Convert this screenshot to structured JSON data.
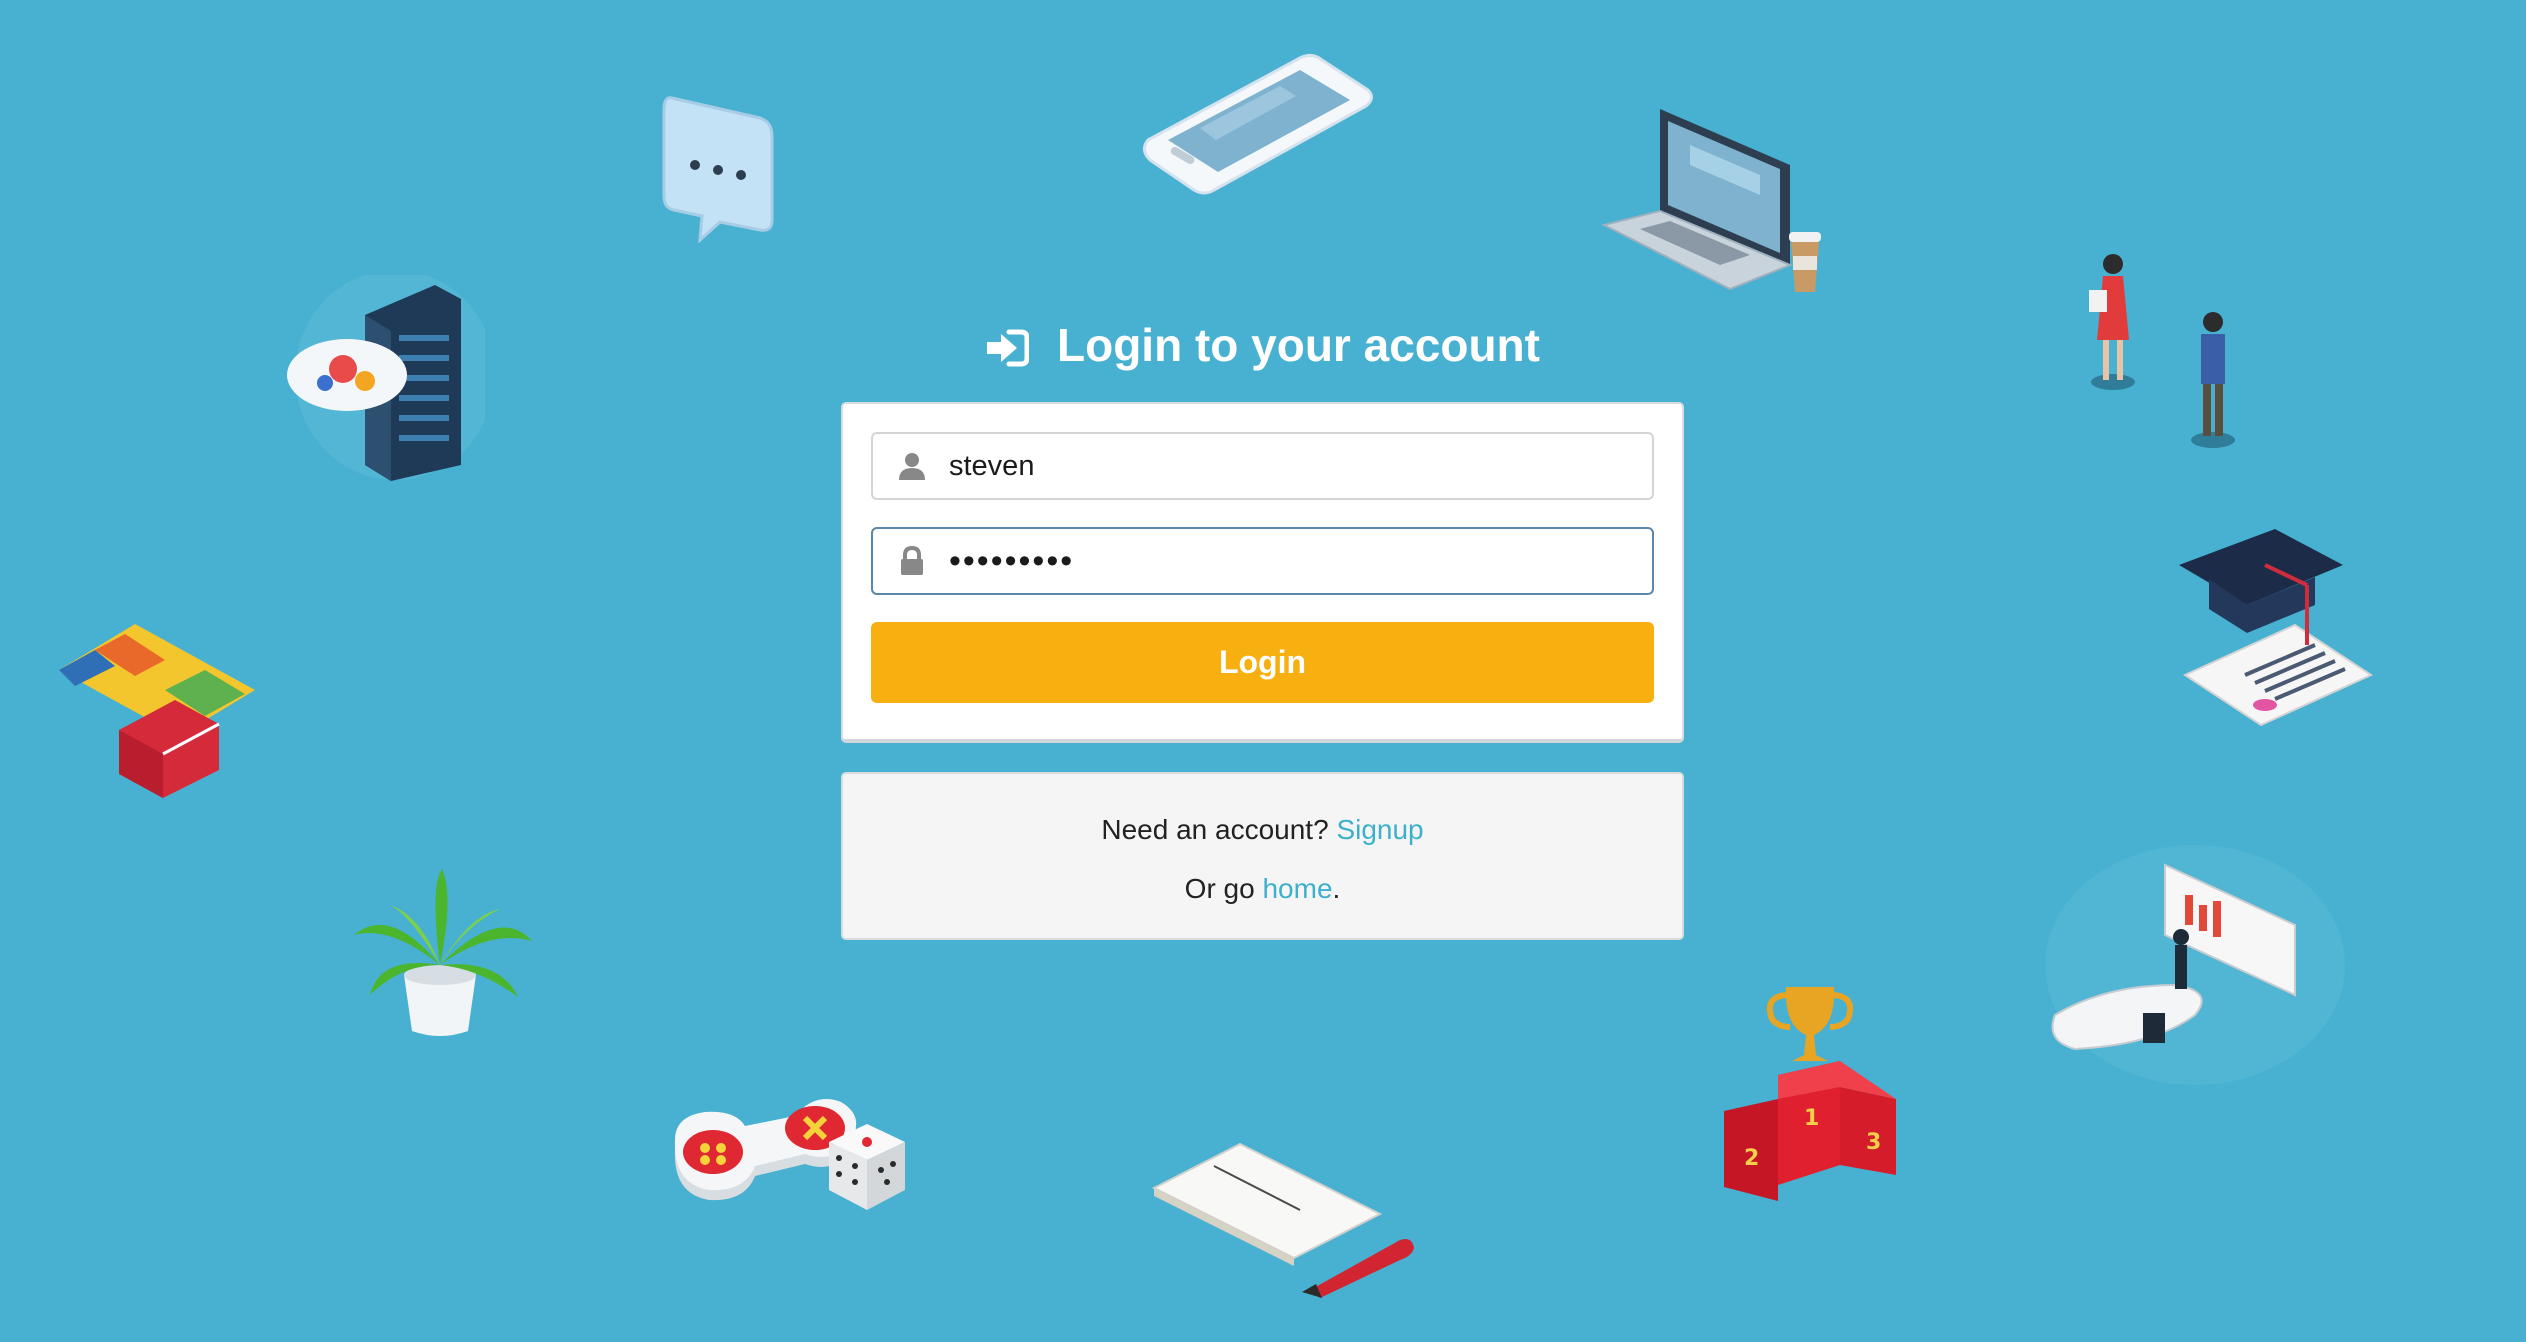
{
  "header": {
    "title": "Login to your account",
    "icon": "sign-in-icon"
  },
  "form": {
    "username": {
      "value": "steven",
      "icon": "user-icon"
    },
    "password": {
      "value": "•••••••••",
      "icon": "lock-icon"
    },
    "submit_label": "Login"
  },
  "message": {
    "need_account": "Need an account?",
    "signup_label": "Signup",
    "or_go": "Or go",
    "home_label": "home",
    "period": "."
  },
  "colors": {
    "background": "#48b1d1",
    "accent": "#f7b010",
    "link": "#3fb0cc",
    "focus_border": "#5b87aa"
  },
  "decorations": [
    "chat-bubble-icon",
    "smartphone-icon",
    "laptop-icon",
    "coffee-cup-icon",
    "cloud-server-icon",
    "people-icon",
    "graduation-cap-icon",
    "map-suitcase-icon",
    "plant-icon",
    "presentation-icon",
    "trophy-podium-icon",
    "gamepad-icon",
    "dice-icon",
    "notebook-icon"
  ]
}
